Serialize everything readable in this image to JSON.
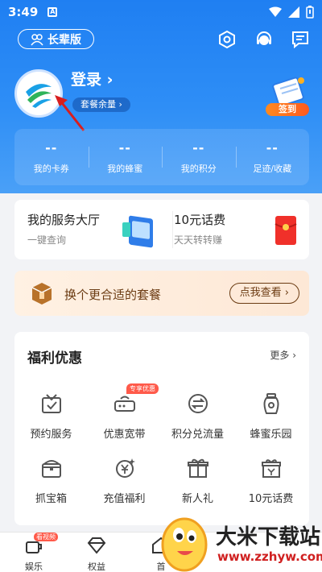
{
  "status_bar": {
    "time": "3:49",
    "a_label": "A"
  },
  "header": {
    "elder_mode": "长辈版"
  },
  "profile": {
    "login": "登录 ›",
    "plan_balance": "套餐余量 ›",
    "signin_label": "签到"
  },
  "stats": [
    {
      "value": "--",
      "label": "我的卡券"
    },
    {
      "value": "--",
      "label": "我的蜂蜜"
    },
    {
      "value": "--",
      "label": "我的积分"
    },
    {
      "value": "--",
      "label": "足迹/收藏"
    }
  ],
  "services": {
    "hall_title": "我的服务大厅",
    "hall_sub": "一键查询",
    "fee_title": "10元话费",
    "fee_sub": "天天转转赚"
  },
  "banner": {
    "text": "换个更合适的套餐",
    "button": "点我查看 ›"
  },
  "welfare": {
    "title": "福利优惠",
    "more": "更多 ›",
    "broadband_flag": "专享优惠",
    "items": [
      "预约服务",
      "优惠宽带",
      "积分兑流量",
      "蜂蜜乐园",
      "抓宝箱",
      "充值福利",
      "新人礼",
      "10元话费"
    ]
  },
  "tabbar": {
    "entertainment": "娱乐",
    "rights": "权益",
    "home_partial": "首",
    "entertainment_flag": "看视频"
  },
  "watermark": {
    "brand": "大米下载站",
    "url": "www.zzhyw.com"
  },
  "colors": {
    "primary": "#1f7ff2",
    "accent_orange": "#ff6a1f",
    "banner_text": "#6b3b12"
  }
}
